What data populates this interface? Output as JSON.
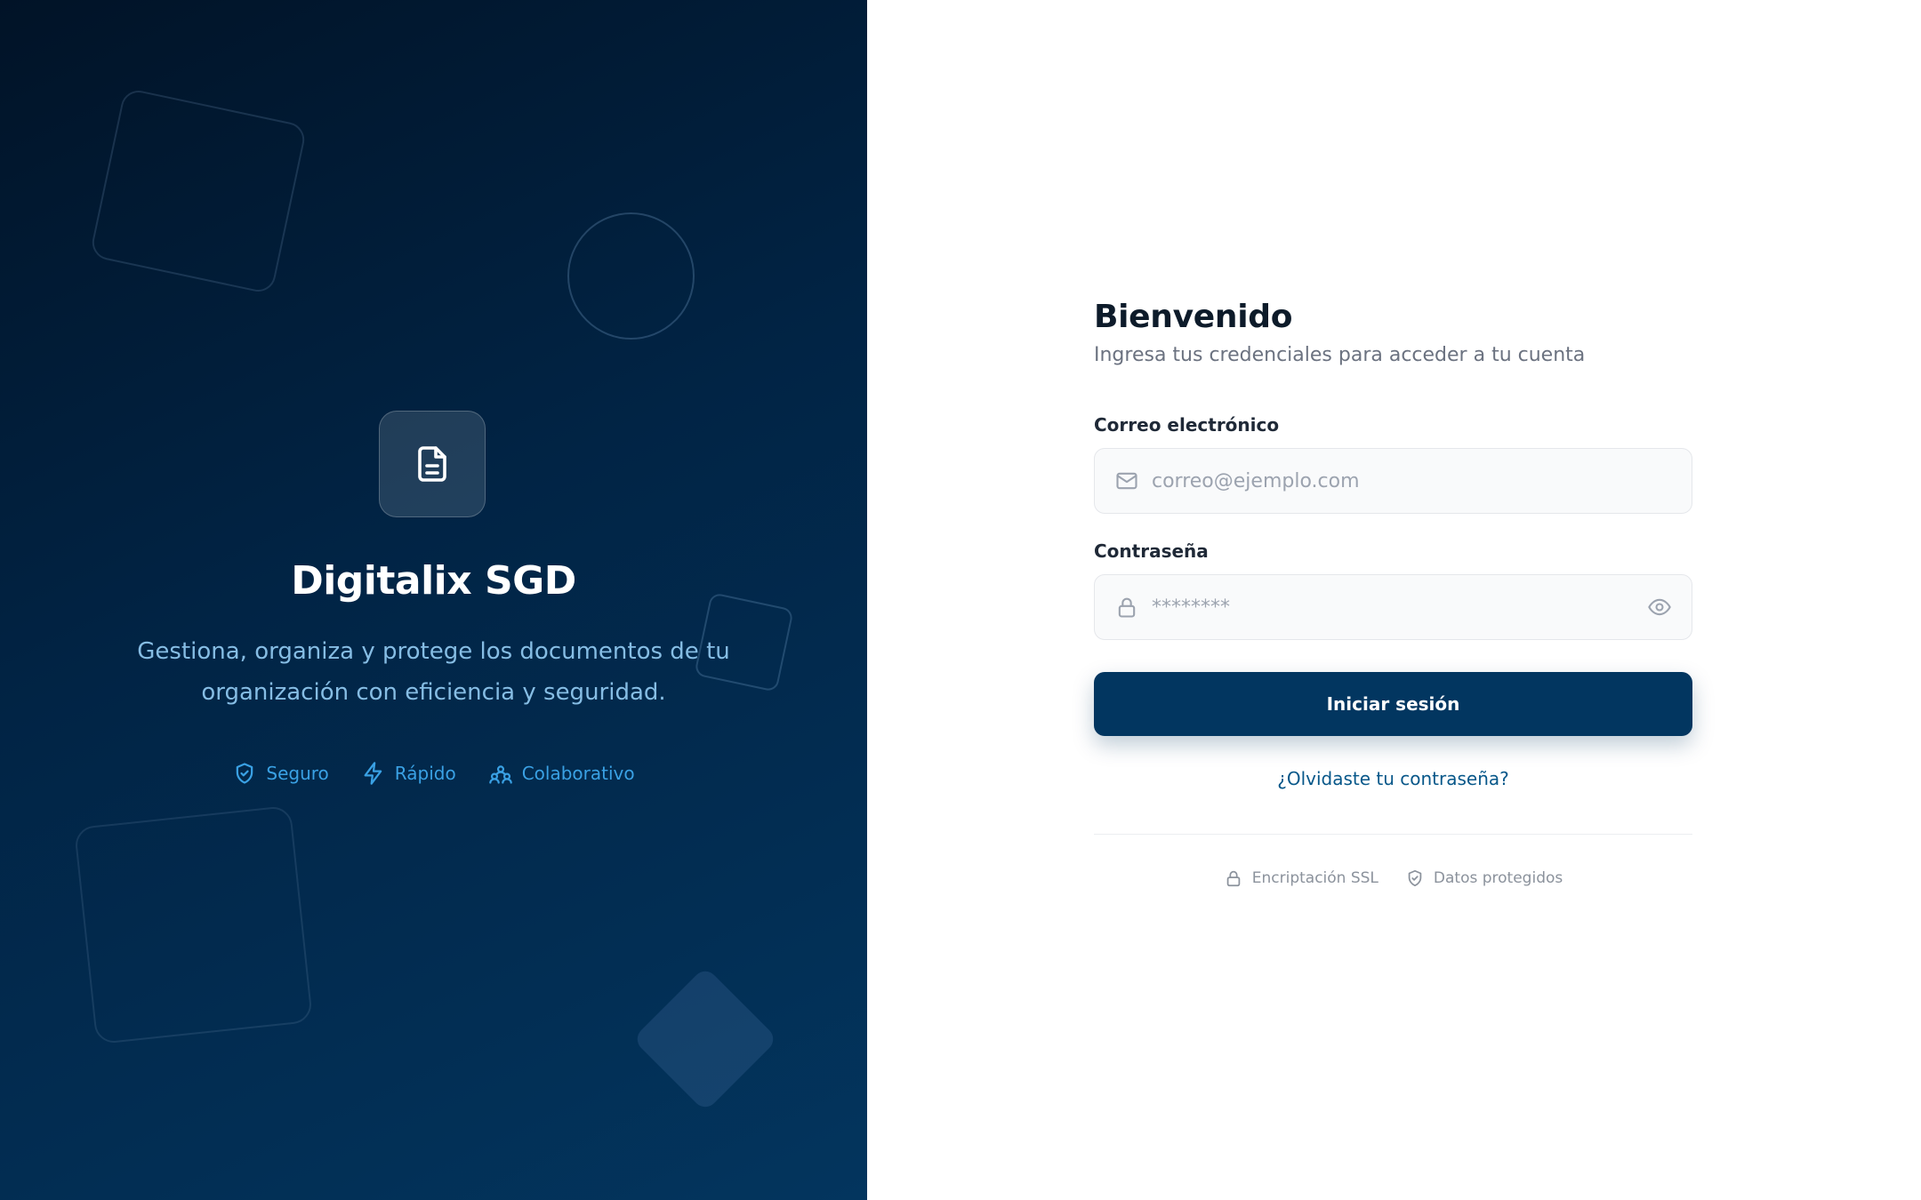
{
  "brand": {
    "title": "Digitalix SGD",
    "tagline": "Gestiona, organiza y protege los documentos de tu organización con eficiencia y seguridad.",
    "logo_icon": "document-icon",
    "features": [
      {
        "label": "Seguro",
        "icon": "shield-check-icon"
      },
      {
        "label": "Rápido",
        "icon": "lightning-icon"
      },
      {
        "label": "Colaborativo",
        "icon": "users-icon"
      }
    ]
  },
  "login": {
    "title": "Bienvenido",
    "subtitle": "Ingresa tus credenciales para acceder a tu cuenta",
    "email": {
      "label": "Correo electrónico",
      "placeholder": "correo@ejemplo.com",
      "value": "",
      "icon": "mail-icon"
    },
    "password": {
      "label": "Contraseña",
      "placeholder": "********",
      "value": "",
      "icon": "lock-icon",
      "toggle_icon": "eye-icon"
    },
    "submit_label": "Iniciar sesión",
    "forgot_label": "¿Olvidaste tu contraseña?",
    "trust": [
      {
        "label": "Encriptación SSL",
        "icon": "lock-icon"
      },
      {
        "label": "Datos protegidos",
        "icon": "shield-check-icon"
      }
    ]
  },
  "colors": {
    "brand_dark": "#011327",
    "brand_mid": "#03355e",
    "primary_button": "#023660",
    "accent": "#3aa1e4",
    "link": "#075789"
  }
}
